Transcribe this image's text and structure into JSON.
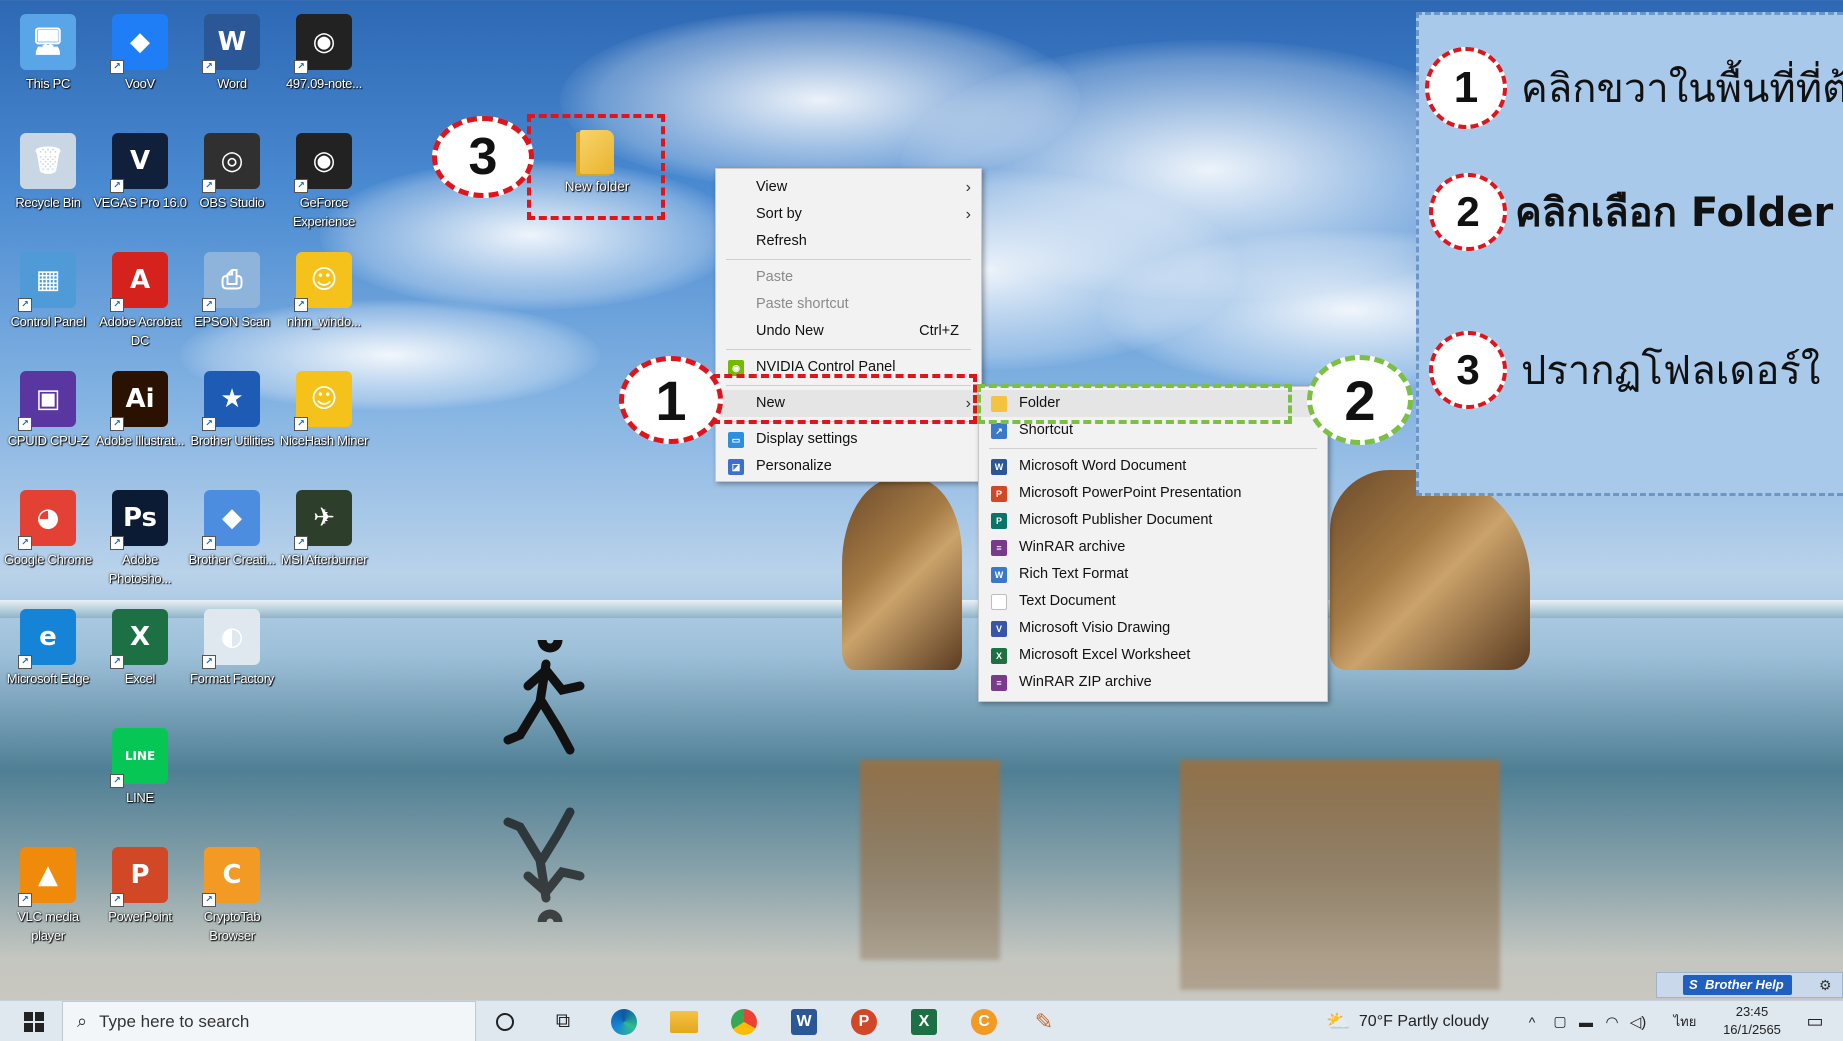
{
  "desktop": {
    "icons": [
      {
        "label": "This PC",
        "glyph": "🖥",
        "color": "#5aa4e8"
      },
      {
        "label": "VooV",
        "glyph": "◆",
        "color": "#1f7ef5"
      },
      {
        "label": "Word",
        "glyph": "W",
        "color": "#2b5797"
      },
      {
        "label": "497.09-note...",
        "glyph": "◉",
        "color": "#222222"
      },
      {
        "label": "Recycle Bin",
        "glyph": "🗑",
        "color": "#c9d7e4"
      },
      {
        "label": "VEGAS Pro 16.0",
        "glyph": "V",
        "color": "#10203a"
      },
      {
        "label": "OBS Studio",
        "glyph": "◎",
        "color": "#303030"
      },
      {
        "label": "GeForce Experience",
        "glyph": "◉",
        "color": "#222222"
      },
      {
        "label": "Control Panel",
        "glyph": "▦",
        "color": "#4e9bd8"
      },
      {
        "label": "Adobe Acrobat DC",
        "glyph": "A",
        "color": "#d5221c"
      },
      {
        "label": "EPSON Scan",
        "glyph": "⎙",
        "color": "#8fb4dc"
      },
      {
        "label": "nhm_windo...",
        "glyph": "☺",
        "color": "#f4c21a"
      },
      {
        "label": "CPUID CPU-Z",
        "glyph": "▣",
        "color": "#5a36a0"
      },
      {
        "label": "Adobe Illustrat...",
        "glyph": "Ai",
        "color": "#2b1200"
      },
      {
        "label": "Brother Utilities",
        "glyph": "★",
        "color": "#1d5bb5"
      },
      {
        "label": "NiceHash Miner",
        "glyph": "☺",
        "color": "#f4c21a"
      },
      {
        "label": "Google Chrome",
        "glyph": "◕",
        "color": "#e34133"
      },
      {
        "label": "Adobe Photosho...",
        "glyph": "Ps",
        "color": "#0b1b33"
      },
      {
        "label": "Brother Creati...",
        "glyph": "◆",
        "color": "#4d8de0"
      },
      {
        "label": "MSI Afterburner",
        "glyph": "✈",
        "color": "#2d3f2a"
      },
      {
        "label": "Microsoft Edge",
        "glyph": "e",
        "color": "#1684d6"
      },
      {
        "label": "Excel",
        "glyph": "X",
        "color": "#1d7044"
      },
      {
        "label": "Format Factory",
        "glyph": "◐",
        "color": "#dfe7ef"
      },
      {
        "label": "LINE",
        "glyph": "LINE",
        "color": "#06c755"
      },
      {
        "label": "VLC media player",
        "glyph": "▲",
        "color": "#f08a0b"
      },
      {
        "label": "PowerPoint",
        "glyph": "P",
        "color": "#d24726"
      },
      {
        "label": "CryptoTab Browser",
        "glyph": "C",
        "color": "#f29a24"
      }
    ],
    "new_folder_label": "New folder"
  },
  "context_menu": {
    "items": [
      {
        "label": "View",
        "submenu": true
      },
      {
        "label": "Sort by",
        "submenu": true
      },
      {
        "label": "Refresh"
      },
      {
        "label": "Paste",
        "disabled": true
      },
      {
        "label": "Paste shortcut",
        "disabled": true
      },
      {
        "label": "Undo New",
        "shortcut": "Ctrl+Z"
      },
      {
        "label": "NVIDIA Control Panel"
      },
      {
        "label": "New",
        "submenu": true
      },
      {
        "label": "Display settings"
      },
      {
        "label": "Personalize"
      }
    ]
  },
  "new_submenu": {
    "items": [
      {
        "label": "Folder",
        "icon": "folder-icon",
        "color": "#f5c342"
      },
      {
        "label": "Shortcut",
        "icon": "shortcut-icon",
        "color": "#3a78c9"
      },
      {
        "label": "Microsoft Word Document",
        "icon": "word-doc-icon",
        "color": "#2b5797"
      },
      {
        "label": "Microsoft PowerPoint Presentation",
        "icon": "powerpoint-doc-icon",
        "color": "#d24726"
      },
      {
        "label": "Microsoft Publisher Document",
        "icon": "publisher-doc-icon",
        "color": "#077568"
      },
      {
        "label": "WinRAR archive",
        "icon": "winrar-icon",
        "color": "#7a3a8c"
      },
      {
        "label": "Rich Text Format",
        "icon": "rtf-icon",
        "color": "#3a78c9"
      },
      {
        "label": "Text Document",
        "icon": "text-doc-icon",
        "color": "#bdbdbd"
      },
      {
        "label": "Microsoft Visio Drawing",
        "icon": "visio-doc-icon",
        "color": "#3955a3"
      },
      {
        "label": "Microsoft Excel Worksheet",
        "icon": "excel-doc-icon",
        "color": "#1d7044"
      },
      {
        "label": "WinRAR ZIP archive",
        "icon": "winrar-zip-icon",
        "color": "#7a3a8c"
      }
    ]
  },
  "annotations": {
    "badge_1": "1",
    "badge_2": "2",
    "badge_3": "3",
    "step_1_text": "คลิกขวาในพื้นที่ที่ต้",
    "step_2_text": "คลิกเลือก Folder",
    "step_3_text": "ปรากฏโฟลเดอร์ใ",
    "red": "#e0141b",
    "green": "#7bc043"
  },
  "brother_help": "Brother Help",
  "taskbar": {
    "search_placeholder": "Type here to search",
    "weather": "70°F Partly cloudy",
    "language": "ไทย",
    "time": "23:45",
    "date": "16/1/2565"
  }
}
